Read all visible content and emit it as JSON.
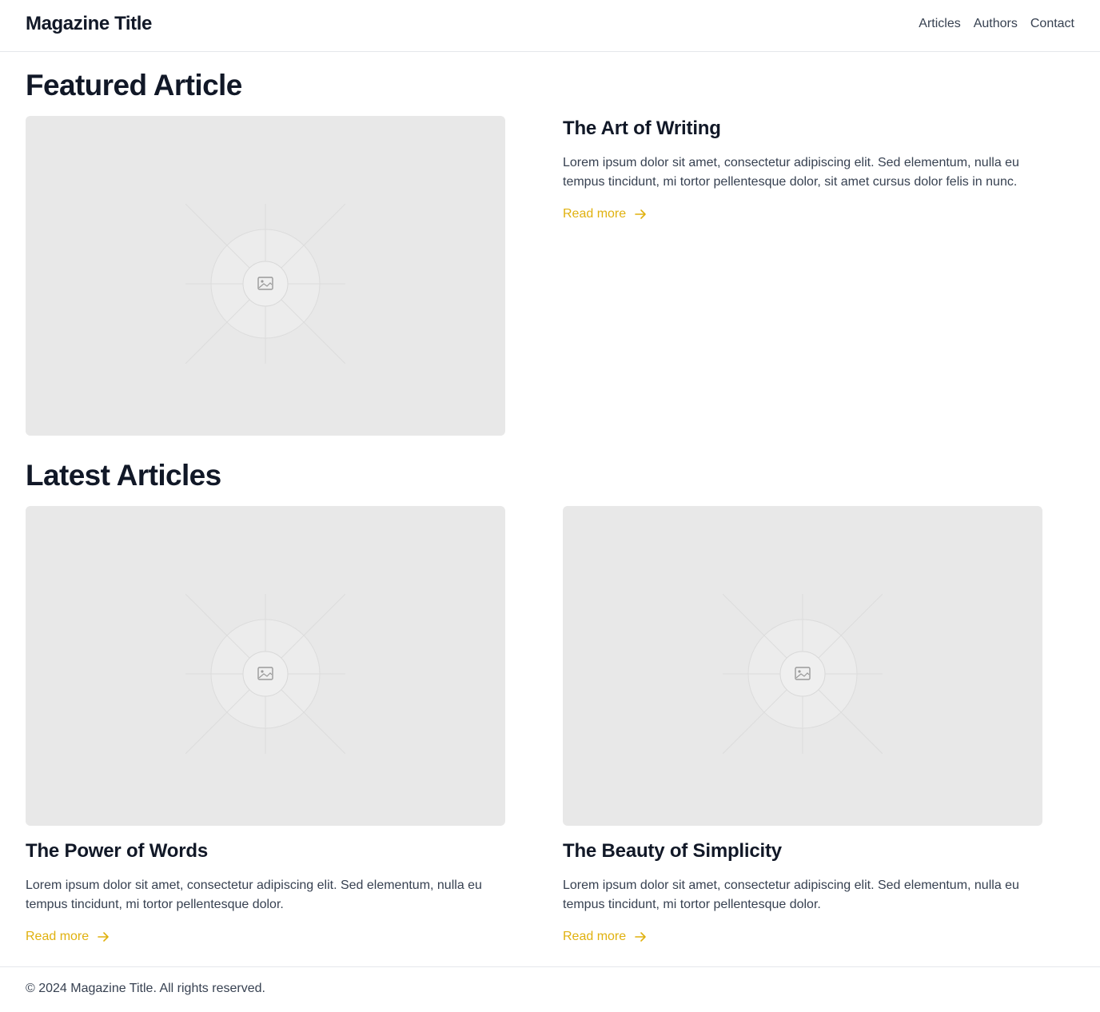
{
  "header": {
    "brand": "Magazine Title",
    "nav": [
      "Articles",
      "Authors",
      "Contact"
    ]
  },
  "featured": {
    "heading": "Featured Article",
    "image_icon": "image-placeholder-icon",
    "title": "The Art of Writing",
    "excerpt": "Lorem ipsum dolor sit amet, consectetur adipiscing elit. Sed elementum, nulla eu tempus tincidunt, mi tortor pellentesque dolor, sit amet cursus dolor felis in nunc.",
    "link": "Read more"
  },
  "latest": {
    "heading": "Latest Articles",
    "articles": [
      {
        "title": "The Power of Words",
        "excerpt": "Lorem ipsum dolor sit amet, consectetur adipiscing elit. Sed elementum, nulla eu tempus tincidunt, mi tortor pellentesque dolor.",
        "link": "Read more"
      },
      {
        "title": "The Beauty of Simplicity",
        "excerpt": "Lorem ipsum dolor sit amet, consectetur adipiscing elit. Sed elementum, nulla eu tempus tincidunt, mi tortor pellentesque dolor.",
        "link": "Read more"
      }
    ]
  },
  "footer": {
    "copyright": "© 2024 Magazine Title. All rights reserved."
  },
  "colors": {
    "accent": "#e0b10f",
    "text": "#111827",
    "muted": "#374151",
    "placeholder": "#e8e8e8",
    "border": "#e5e7eb"
  }
}
